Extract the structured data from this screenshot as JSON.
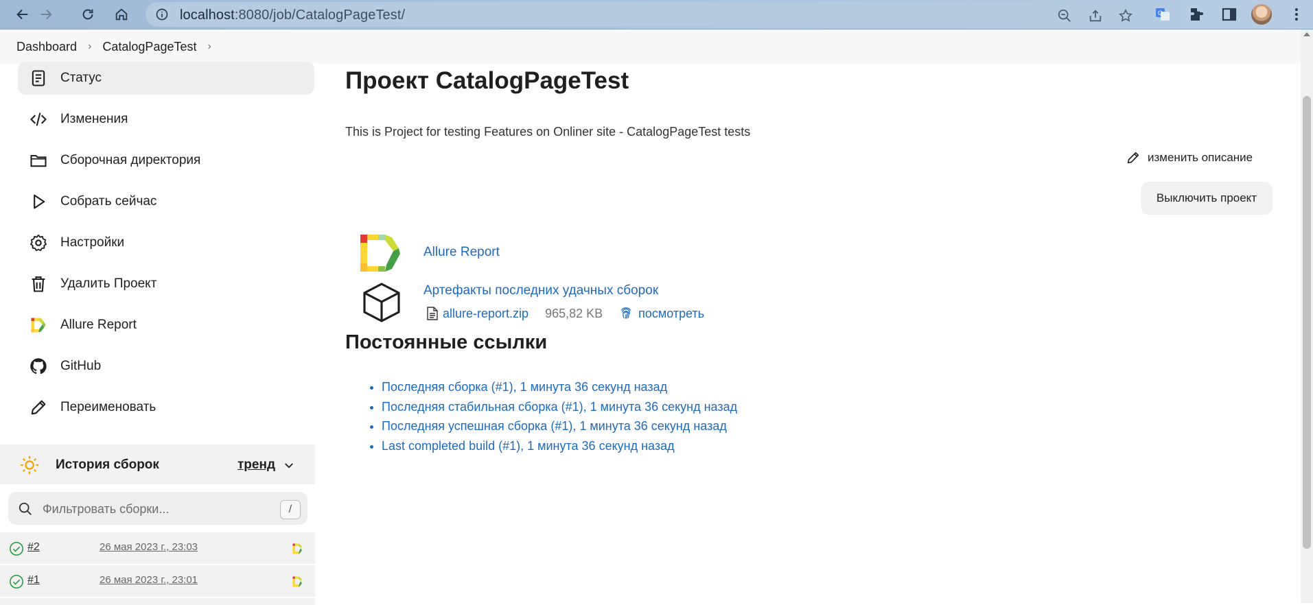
{
  "browser": {
    "url_host": "localhost",
    "url_path": ":8080/job/CatalogPageTest/"
  },
  "breadcrumb": {
    "items": [
      "Dashboard",
      "CatalogPageTest"
    ]
  },
  "sidebar": {
    "items": [
      {
        "label": "Статус",
        "icon": "status-document-icon"
      },
      {
        "label": "Изменения",
        "icon": "code-icon"
      },
      {
        "label": "Сборочная директория",
        "icon": "folder-icon"
      },
      {
        "label": "Собрать сейчас",
        "icon": "play-icon"
      },
      {
        "label": "Настройки",
        "icon": "gear-icon"
      },
      {
        "label": "Удалить Проект",
        "icon": "trash-icon"
      },
      {
        "label": "Allure Report",
        "icon": "allure-icon"
      },
      {
        "label": "GitHub",
        "icon": "github-icon"
      },
      {
        "label": "Переименовать",
        "icon": "pencil-icon"
      }
    ]
  },
  "build_history": {
    "title": "История сборок",
    "trend_label": "тренд",
    "filter_placeholder": "Фильтровать сборки...",
    "filter_shortcut": "/",
    "builds": [
      {
        "number": "#2",
        "date": "26 мая 2023 г., 23:03",
        "status": "success"
      },
      {
        "number": "#1",
        "date": "26 мая 2023 г., 23:01",
        "status": "success"
      }
    ]
  },
  "main": {
    "title": "Проект CatalogPageTest",
    "description": "This is Project for testing Features on Onliner site - CatalogPageTest tests",
    "edit_description_label": "изменить описание",
    "disable_project_label": "Выключить проект",
    "allure_report_label": "Allure Report",
    "artifacts_label": "Артефакты последних удачных сборок",
    "artifact": {
      "file_name": "allure-report.zip",
      "file_size": "965,82 KB",
      "view_label": "посмотреть"
    },
    "permalinks_title": "Постоянные ссылки",
    "permalinks": [
      "Последняя сборка (#1), 1 минута 36 секунд назад",
      "Последняя стабильная сборка (#1), 1 минута 36 секунд назад",
      "Последняя успешная сборка (#1), 1 минута 36 секунд назад",
      "Last completed build (#1), 1 минута 36 секунд назад"
    ]
  },
  "colors": {
    "link": "#1d6bbf",
    "success": "#2e9e4a",
    "sidebar_active": "#eeeef0"
  }
}
